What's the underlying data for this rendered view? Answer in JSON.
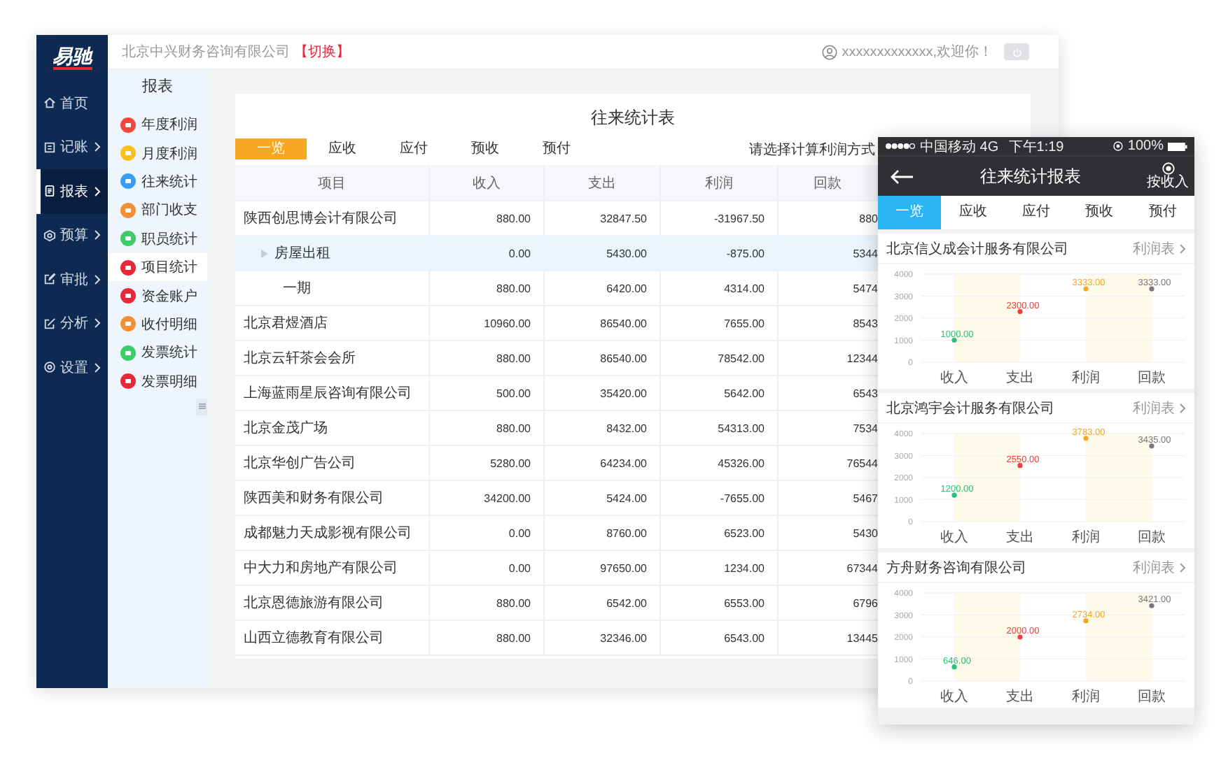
{
  "sidebar": {
    "logo": "易驰",
    "items": [
      {
        "label": "首页",
        "kind": "link",
        "selected": false
      },
      {
        "label": "记账",
        "kind": "menu",
        "selected": false
      },
      {
        "label": "报表",
        "kind": "menu",
        "selected": true
      },
      {
        "label": "预算",
        "kind": "menu",
        "selected": false
      },
      {
        "label": "审批",
        "kind": "menu",
        "selected": false
      },
      {
        "label": "分析",
        "kind": "menu",
        "selected": false
      },
      {
        "label": "设置",
        "kind": "menu",
        "selected": false
      }
    ]
  },
  "header": {
    "company": "北京中兴财务咨询有限公司",
    "switch_link": "【切换】",
    "greeting": "xxxxxxxxxxxxx,欢迎你！"
  },
  "subnav": {
    "title": "报表",
    "items": [
      {
        "label": "年度利润",
        "color": "#f0483e",
        "selected": false
      },
      {
        "label": "月度利润",
        "color": "#f8c21c",
        "selected": false
      },
      {
        "label": "往来统计",
        "color": "#3a9cf5",
        "selected": false
      },
      {
        "label": "部门收支",
        "color": "#f39035",
        "selected": false
      },
      {
        "label": "职员统计",
        "color": "#3ecb6a",
        "selected": false
      },
      {
        "label": "项目统计",
        "color": "#e8283a",
        "selected": true
      },
      {
        "label": "资金账户",
        "color": "#e8283a",
        "selected": false
      },
      {
        "label": "收付明细",
        "color": "#f39035",
        "selected": false
      },
      {
        "label": "发票统计",
        "color": "#3ecb6a",
        "selected": false
      },
      {
        "label": "发票明细",
        "color": "#e8283a",
        "selected": false
      }
    ]
  },
  "report": {
    "title": "往来统计表",
    "tabs": [
      {
        "label": "一览",
        "selected": true
      },
      {
        "label": "应收",
        "selected": false
      },
      {
        "label": "应付",
        "selected": false
      },
      {
        "label": "预收",
        "selected": false
      },
      {
        "label": "预付",
        "selected": false
      }
    ],
    "calc_hint": "请选择计算利润方式",
    "columns": [
      "项目",
      "收入",
      "支出",
      "利润",
      "回款"
    ],
    "rows": [
      {
        "name": "陕西创思博会计有限公司",
        "cells": [
          "880.00",
          "32847.50",
          "-31967.50",
          "880"
        ],
        "selected": false,
        "children": [
          {
            "name": "房屋出租",
            "cells": [
              "0.00",
              "5430.00",
              "-875.00",
              "5344"
            ],
            "selected": true,
            "children": [
              {
                "name": "一期",
                "cells": [
                  "880.00",
                  "6420.00",
                  "4314.00",
                  "5474"
                ],
                "selected": false
              }
            ]
          }
        ]
      },
      {
        "name": "北京君煜酒店",
        "cells": [
          "10960.00",
          "86540.00",
          "7655.00",
          "8543"
        ],
        "selected": false
      },
      {
        "name": "北京云轩茶会会所",
        "cells": [
          "880.00",
          "86540.00",
          "78542.00",
          "12344"
        ],
        "selected": false
      },
      {
        "name": "上海蓝雨星辰咨询有限公司",
        "cells": [
          "500.00",
          "35420.00",
          "5642.00",
          "6543"
        ],
        "selected": false
      },
      {
        "name": "北京金茂广场",
        "cells": [
          "880.00",
          "8432.00",
          "54313.00",
          "7534"
        ],
        "selected": false
      },
      {
        "name": "北京华创广告公司",
        "cells": [
          "5280.00",
          "64234.00",
          "45326.00",
          "76544"
        ],
        "selected": false
      },
      {
        "name": "陕西美和财务有限公司",
        "cells": [
          "34200.00",
          "5424.00",
          "-7655.00",
          "5467"
        ],
        "selected": false
      },
      {
        "name": "成都魅力天成影视有限公司",
        "cells": [
          "0.00",
          "8760.00",
          "6523.00",
          "5430"
        ],
        "selected": false
      },
      {
        "name": "中大力和房地产有限公司",
        "cells": [
          "0.00",
          "97650.00",
          "1234.00",
          "67344"
        ],
        "selected": false
      },
      {
        "name": "北京恩德旅游有限公司",
        "cells": [
          "880.00",
          "6542.00",
          "6553.00",
          "6796"
        ],
        "selected": false
      },
      {
        "name": "山西立德教育有限公司",
        "cells": [
          "880.00",
          "32346.00",
          "6543.00",
          "13445"
        ],
        "selected": false
      }
    ]
  },
  "phone": {
    "status_bar": {
      "carrier": "中国移动 4G",
      "time": "下午1:19",
      "battery": "100%"
    },
    "title": "往来统计报表",
    "action_label": "按收入",
    "tabs": [
      {
        "label": "一览",
        "selected": true
      },
      {
        "label": "应收",
        "selected": false
      },
      {
        "label": "应付",
        "selected": false
      },
      {
        "label": "预收",
        "selected": false
      },
      {
        "label": "预付",
        "selected": false
      }
    ],
    "cards": [
      {
        "company": "北京信义成会计服务有限公司",
        "link": "利润表",
        "chart_data": {
          "type": "scatter",
          "categories": [
            "收入",
            "支出",
            "利润",
            "回款"
          ],
          "ylim": [
            0,
            4000
          ],
          "yticks": [
            0,
            1000,
            2000,
            3000,
            4000
          ],
          "grid": true,
          "value_labels": [
            "1000.00",
            "2300.00",
            "3333.00",
            "3333.00"
          ],
          "series": [
            {
              "color": "#27c07a",
              "values": [
                1000,
                null,
                null,
                null
              ]
            },
            {
              "color": "#e8423a",
              "values": [
                null,
                2300,
                null,
                null
              ]
            },
            {
              "color": "#f5a623",
              "values": [
                null,
                null,
                3333,
                null
              ]
            },
            {
              "color": "#777777",
              "values": [
                null,
                null,
                null,
                3333
              ]
            }
          ]
        }
      },
      {
        "company": "北京鸿宇会计服务有限公司",
        "link": "利润表",
        "chart_data": {
          "type": "scatter",
          "categories": [
            "收入",
            "支出",
            "利润",
            "回款"
          ],
          "ylim": [
            0,
            4000
          ],
          "yticks": [
            0,
            1000,
            2000,
            3000,
            4000
          ],
          "grid": true,
          "value_labels": [
            "1200.00",
            "2550.00",
            "3783.00",
            "3435.00"
          ],
          "series": [
            {
              "color": "#27c07a",
              "values": [
                1200,
                null,
                null,
                null
              ]
            },
            {
              "color": "#e8423a",
              "values": [
                null,
                2550,
                null,
                null
              ]
            },
            {
              "color": "#f5a623",
              "values": [
                null,
                null,
                3783,
                null
              ]
            },
            {
              "color": "#777777",
              "values": [
                null,
                null,
                null,
                3435
              ]
            }
          ]
        }
      },
      {
        "company": "方舟财务咨询有限公司",
        "link": "利润表",
        "chart_data": {
          "type": "scatter",
          "categories": [
            "收入",
            "支出",
            "利润",
            "回款"
          ],
          "ylim": [
            0,
            4000
          ],
          "yticks": [
            0,
            1000,
            2000,
            3000,
            4000
          ],
          "grid": true,
          "value_labels": [
            "646.00",
            "2000.00",
            "2734.00",
            "3421.00"
          ],
          "series": [
            {
              "color": "#27c07a",
              "values": [
                646,
                null,
                null,
                null
              ]
            },
            {
              "color": "#e8423a",
              "values": [
                null,
                2000,
                null,
                null
              ]
            },
            {
              "color": "#f5a623",
              "values": [
                null,
                null,
                2734,
                null
              ]
            },
            {
              "color": "#777777",
              "values": [
                null,
                null,
                null,
                3421
              ]
            }
          ]
        }
      }
    ]
  }
}
